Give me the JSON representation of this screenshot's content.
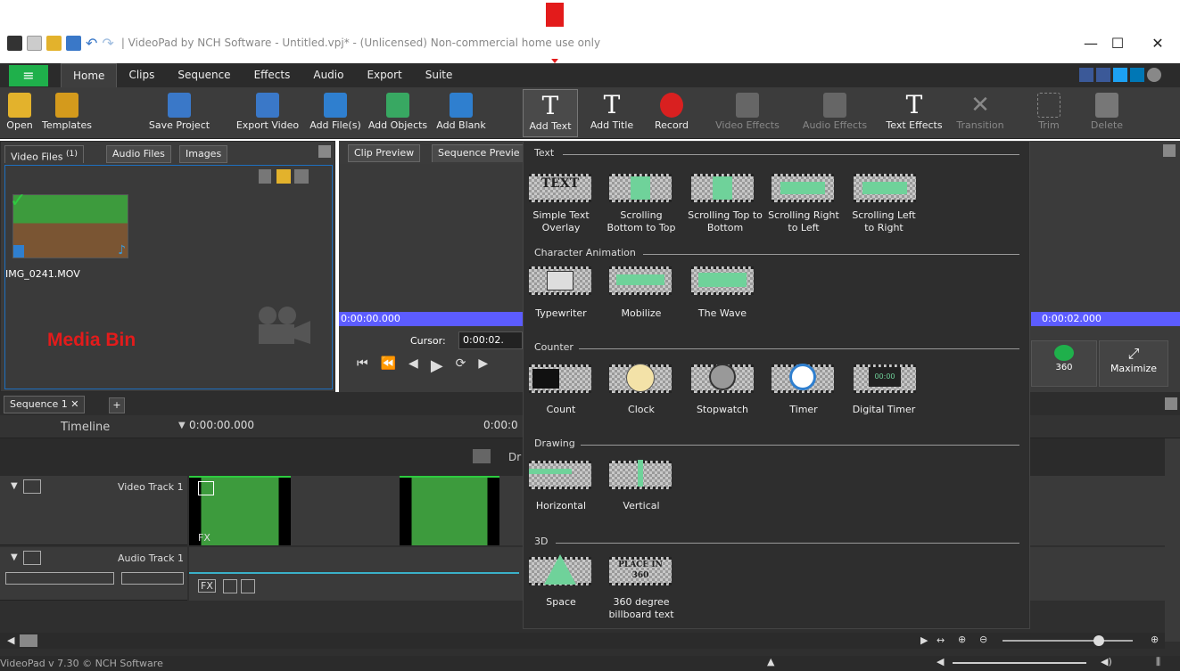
{
  "window": {
    "title": "| VideoPad by NCH Software - Untitled.vpj* - (Unlicensed) Non-commercial home use only",
    "minimize": "—",
    "maximize": "☐",
    "close": "✕"
  },
  "menu": {
    "hamburger": "≡",
    "tabs": [
      "Home",
      "Clips",
      "Sequence",
      "Effects",
      "Audio",
      "Export",
      "Suite"
    ]
  },
  "toolbar": {
    "open": "Open",
    "templates": "Templates",
    "save_project": "Save Project",
    "export_video": "Export Video",
    "add_files": "Add File(s)",
    "add_objects": "Add Objects",
    "add_blank": "Add Blank",
    "add_text": "Add Text",
    "add_title": "Add Title",
    "record": "Record",
    "video_effects": "Video Effects",
    "audio_effects": "Audio Effects",
    "text_effects": "Text Effects",
    "transition": "Transition",
    "trim": "Trim",
    "delete": "Delete"
  },
  "bin": {
    "tab_video": "Video Files",
    "tab_video_count": "(1)",
    "tab_audio": "Audio Files",
    "tab_images": "Images",
    "file_name": "IMG_0241.MOV",
    "annotation": "Media Bin"
  },
  "preview": {
    "tab_clip": "Clip Preview",
    "tab_sequence": "Sequence Previe",
    "time_start": "0:00:00.000",
    "time_right": "0:00:02.000",
    "cursor_label": "Cursor:",
    "cursor_value": "0:00:02.",
    "btn_360": "360",
    "btn_maximize": "Maximize"
  },
  "timeline": {
    "sequence_tab": "Sequence 1",
    "add_tab": "+",
    "timeline_label": "Timeline",
    "time_start": "0:00:00.000",
    "time_mid": "0:00:0",
    "drop_hint": "Dr",
    "video_track": "Video Track 1",
    "audio_track": "Audio Track 1",
    "fx": "FX"
  },
  "dropdown": {
    "sections": [
      {
        "title": "Text",
        "items": [
          "Simple Text Overlay",
          "Scrolling Bottom to Top",
          "Scrolling Top to Bottom",
          "Scrolling Right to Left",
          "Scrolling Left to Right"
        ]
      },
      {
        "title": "Character Animation",
        "items": [
          "Typewriter",
          "Mobilize",
          "The Wave"
        ]
      },
      {
        "title": "Counter",
        "items": [
          "Count",
          "Clock",
          "Stopwatch",
          "Timer",
          "Digital Timer"
        ]
      },
      {
        "title": "Drawing",
        "items": [
          "Horizontal",
          "Vertical"
        ]
      },
      {
        "title": "3D",
        "items": [
          "Space",
          "360 degree billboard text"
        ]
      }
    ],
    "thumb_text": "TEXT",
    "thumb_billboard": "PLACE IN 360",
    "thumb_timer": "00:00"
  },
  "status": {
    "version": "VideoPad v 7.30 © NCH Software"
  },
  "colors": {
    "accent_green": "#1fb04b",
    "annotation_red": "#e31b1b",
    "playhead_band": "#5c5cff"
  }
}
